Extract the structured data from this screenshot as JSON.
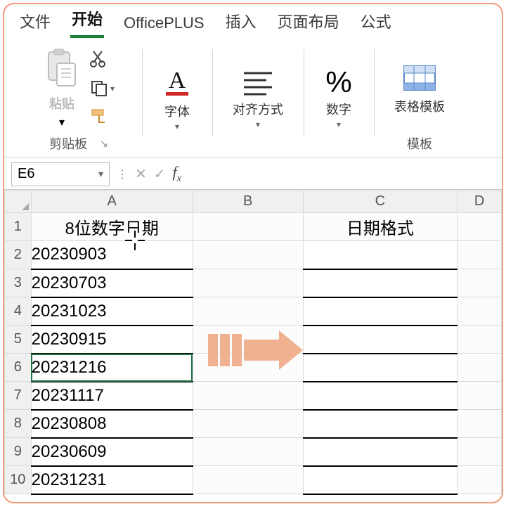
{
  "tabs": {
    "file": "文件",
    "home": "开始",
    "officeplus": "OfficePLUS",
    "insert": "插入",
    "layout": "页面布局",
    "formula": "公式"
  },
  "ribbon": {
    "clipboard": {
      "paste_label": "粘贴",
      "group_label": "剪贴板"
    },
    "font": {
      "label": "字体"
    },
    "alignment": {
      "label": "对齐方式"
    },
    "number": {
      "label": "数字"
    },
    "templates": {
      "label": "表格模板",
      "group_label": "模板"
    }
  },
  "icons": {
    "cut": "cut-icon",
    "copy": "copy-icon",
    "brush": "format-painter-icon",
    "paste": "clipboard-paste-icon",
    "font": "font-a-icon",
    "align": "align-lines-icon",
    "percent": "percent-icon",
    "table": "table-template-icon"
  },
  "namebox": {
    "value": "E6"
  },
  "formulabar": {
    "value": ""
  },
  "columns": {
    "A": "A",
    "B": "B",
    "C": "C",
    "D": "D"
  },
  "headers": {
    "col_a": "8位数字日期",
    "col_c": "日期格式"
  },
  "rows": [
    {
      "n": "1",
      "a_header": true
    },
    {
      "n": "2",
      "a": "20230903"
    },
    {
      "n": "3",
      "a": "20230703"
    },
    {
      "n": "4",
      "a": "20231023"
    },
    {
      "n": "5",
      "a": "20230915"
    },
    {
      "n": "6",
      "a": "20231216",
      "selected": true
    },
    {
      "n": "7",
      "a": "20231117"
    },
    {
      "n": "8",
      "a": "20230808"
    },
    {
      "n": "9",
      "a": "20230609"
    },
    {
      "n": "10",
      "a": "20231231"
    }
  ],
  "colors": {
    "accent": "#217346",
    "arrow": "#f0b190",
    "frame": "#f39b7b"
  }
}
